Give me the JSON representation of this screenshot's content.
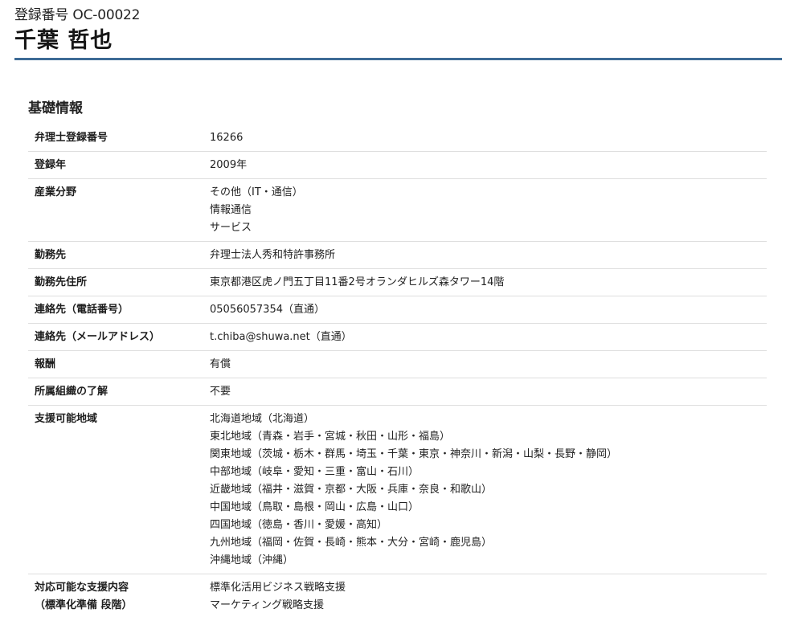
{
  "header": {
    "registration_label": "登録番号",
    "registration_code": "OC-00022",
    "name": "千葉 哲也"
  },
  "section": {
    "title": "基礎情報"
  },
  "rows": [
    {
      "label": "弁理士登録番号",
      "values": [
        "16266"
      ]
    },
    {
      "label": "登録年",
      "values": [
        "2009年"
      ]
    },
    {
      "label": "産業分野",
      "values": [
        "その他（IT・通信）",
        "情報通信",
        "サービス"
      ]
    },
    {
      "label": "勤務先",
      "values": [
        "弁理士法人秀和特許事務所"
      ]
    },
    {
      "label": "勤務先住所",
      "values": [
        "東京都港区虎ノ門五丁目11番2号オランダヒルズ森タワー14階"
      ]
    },
    {
      "label": "連絡先（電話番号）",
      "values": [
        "05056057354（直通）"
      ]
    },
    {
      "label": "連絡先（メールアドレス）",
      "values": [
        "t.chiba@shuwa.net（直通）"
      ]
    },
    {
      "label": "報酬",
      "values": [
        "有償"
      ]
    },
    {
      "label": "所属組織の了解",
      "values": [
        "不要"
      ]
    },
    {
      "label": "支援可能地域",
      "values": [
        "北海道地域（北海道）",
        "東北地域（青森・岩手・宮城・秋田・山形・福島）",
        "関東地域（茨城・栃木・群馬・埼玉・千葉・東京・神奈川・新潟・山梨・長野・静岡）",
        "中部地域（岐阜・愛知・三重・富山・石川）",
        "近畿地域（福井・滋賀・京都・大阪・兵庫・奈良・和歌山）",
        "中国地域（鳥取・島根・岡山・広島・山口）",
        "四国地域（徳島・香川・愛媛・高知）",
        "九州地域（福岡・佐賀・長崎・熊本・大分・宮崎・鹿児島）",
        "沖縄地域（沖縄）"
      ]
    },
    {
      "label": "対応可能な支援内容",
      "label2": "（標準化準備 段階）",
      "values": [
        "標準化活用ビジネス戦略支援",
        "マーケティング戦略支援"
      ]
    }
  ]
}
